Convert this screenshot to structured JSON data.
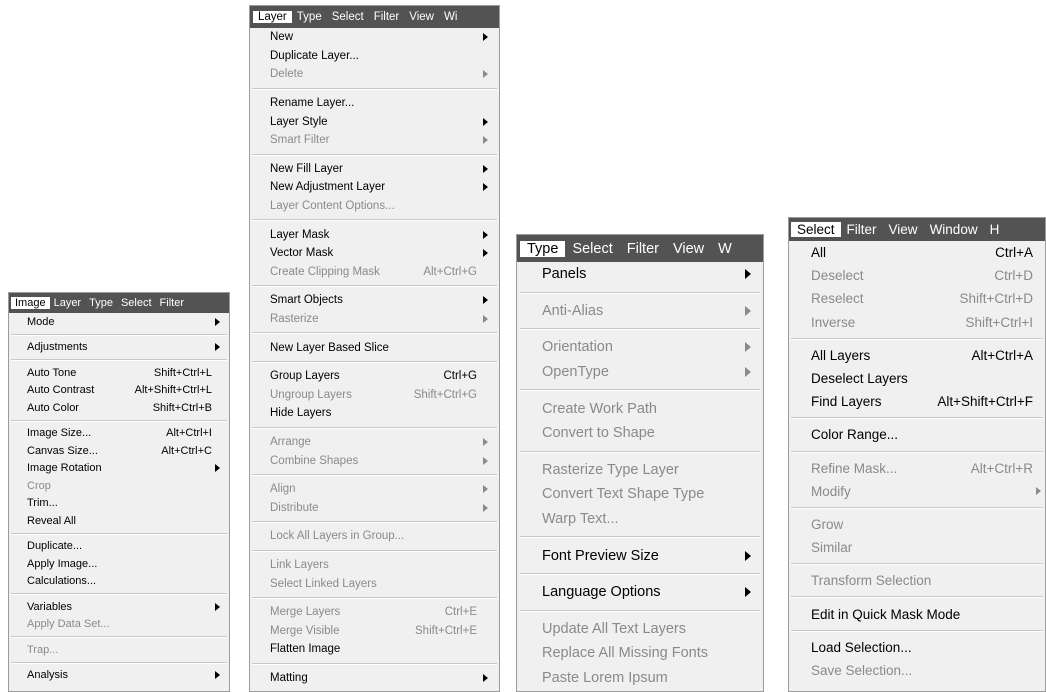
{
  "image_menu": {
    "menubar": [
      "Image",
      "Layer",
      "Type",
      "Select",
      "Filter"
    ],
    "groups": [
      [
        {
          "label": "Mode",
          "submenu": true
        }
      ],
      [
        {
          "label": "Adjustments",
          "submenu": true
        }
      ],
      [
        {
          "label": "Auto Tone",
          "shortcut": "Shift+Ctrl+L"
        },
        {
          "label": "Auto Contrast",
          "shortcut": "Alt+Shift+Ctrl+L"
        },
        {
          "label": "Auto Color",
          "shortcut": "Shift+Ctrl+B"
        }
      ],
      [
        {
          "label": "Image Size...",
          "shortcut": "Alt+Ctrl+I"
        },
        {
          "label": "Canvas Size...",
          "shortcut": "Alt+Ctrl+C"
        },
        {
          "label": "Image Rotation",
          "submenu": true
        },
        {
          "label": "Crop",
          "disabled": true
        },
        {
          "label": "Trim..."
        },
        {
          "label": "Reveal All"
        }
      ],
      [
        {
          "label": "Duplicate..."
        },
        {
          "label": "Apply Image..."
        },
        {
          "label": "Calculations..."
        }
      ],
      [
        {
          "label": "Variables",
          "submenu": true
        },
        {
          "label": "Apply Data Set...",
          "disabled": true
        }
      ],
      [
        {
          "label": "Trap...",
          "disabled": true
        }
      ],
      [
        {
          "label": "Analysis",
          "submenu": true
        }
      ]
    ]
  },
  "layer_menu": {
    "menubar": [
      "Layer",
      "Type",
      "Select",
      "Filter",
      "View",
      "Wi"
    ],
    "groups": [
      [
        {
          "label": "New",
          "submenu": true
        },
        {
          "label": "Duplicate Layer..."
        },
        {
          "label": "Delete",
          "submenu": true,
          "disabled": true
        }
      ],
      [
        {
          "label": "Rename Layer..."
        },
        {
          "label": "Layer Style",
          "submenu": true
        },
        {
          "label": "Smart Filter",
          "submenu": true,
          "disabled": true
        }
      ],
      [
        {
          "label": "New Fill Layer",
          "submenu": true
        },
        {
          "label": "New Adjustment Layer",
          "submenu": true
        },
        {
          "label": "Layer Content Options...",
          "disabled": true
        }
      ],
      [
        {
          "label": "Layer Mask",
          "submenu": true
        },
        {
          "label": "Vector Mask",
          "submenu": true
        },
        {
          "label": "Create Clipping Mask",
          "shortcut": "Alt+Ctrl+G",
          "disabled": true
        }
      ],
      [
        {
          "label": "Smart Objects",
          "submenu": true
        },
        {
          "label": "Rasterize",
          "submenu": true,
          "disabled": true
        }
      ],
      [
        {
          "label": "New Layer Based Slice"
        }
      ],
      [
        {
          "label": "Group Layers",
          "shortcut": "Ctrl+G"
        },
        {
          "label": "Ungroup Layers",
          "shortcut": "Shift+Ctrl+G",
          "disabled": true
        },
        {
          "label": "Hide Layers"
        }
      ],
      [
        {
          "label": "Arrange",
          "submenu": true,
          "disabled": true
        },
        {
          "label": "Combine Shapes",
          "submenu": true,
          "disabled": true
        }
      ],
      [
        {
          "label": "Align",
          "submenu": true,
          "disabled": true
        },
        {
          "label": "Distribute",
          "submenu": true,
          "disabled": true
        }
      ],
      [
        {
          "label": "Lock All Layers in Group...",
          "disabled": true
        }
      ],
      [
        {
          "label": "Link Layers",
          "disabled": true
        },
        {
          "label": "Select Linked Layers",
          "disabled": true
        }
      ],
      [
        {
          "label": "Merge Layers",
          "shortcut": "Ctrl+E",
          "disabled": true
        },
        {
          "label": "Merge Visible",
          "shortcut": "Shift+Ctrl+E",
          "disabled": true
        },
        {
          "label": "Flatten Image"
        }
      ],
      [
        {
          "label": "Matting",
          "submenu": true
        }
      ]
    ]
  },
  "type_menu": {
    "menubar": [
      "Type",
      "Select",
      "Filter",
      "View",
      "W"
    ],
    "groups": [
      [
        {
          "label": "Panels",
          "submenu": true
        }
      ],
      [
        {
          "label": "Anti-Alias",
          "submenu": true,
          "disabled": true
        }
      ],
      [
        {
          "label": "Orientation",
          "submenu": true,
          "disabled": true
        },
        {
          "label": "OpenType",
          "submenu": true,
          "disabled": true
        }
      ],
      [
        {
          "label": "Create Work Path",
          "disabled": true
        },
        {
          "label": "Convert to Shape",
          "disabled": true
        }
      ],
      [
        {
          "label": "Rasterize Type Layer",
          "disabled": true
        },
        {
          "label": "Convert Text Shape Type",
          "disabled": true
        },
        {
          "label": "Warp Text...",
          "disabled": true
        }
      ],
      [
        {
          "label": "Font Preview Size",
          "submenu": true
        }
      ],
      [
        {
          "label": "Language Options",
          "submenu": true
        }
      ],
      [
        {
          "label": "Update All Text Layers",
          "disabled": true
        },
        {
          "label": "Replace All Missing Fonts",
          "disabled": true
        },
        {
          "label": "Paste Lorem Ipsum",
          "disabled": true
        }
      ]
    ]
  },
  "select_menu": {
    "menubar": [
      "Select",
      "Filter",
      "View",
      "Window",
      "H"
    ],
    "groups": [
      [
        {
          "label": "All",
          "shortcut": "Ctrl+A"
        },
        {
          "label": "Deselect",
          "shortcut": "Ctrl+D",
          "disabled": true
        },
        {
          "label": "Reselect",
          "shortcut": "Shift+Ctrl+D",
          "disabled": true
        },
        {
          "label": "Inverse",
          "shortcut": "Shift+Ctrl+I",
          "disabled": true
        }
      ],
      [
        {
          "label": "All Layers",
          "shortcut": "Alt+Ctrl+A"
        },
        {
          "label": "Deselect Layers"
        },
        {
          "label": "Find Layers",
          "shortcut": "Alt+Shift+Ctrl+F"
        }
      ],
      [
        {
          "label": "Color Range..."
        }
      ],
      [
        {
          "label": "Refine Mask...",
          "shortcut": "Alt+Ctrl+R",
          "disabled": true
        },
        {
          "label": "Modify",
          "submenu": true,
          "disabled": true
        }
      ],
      [
        {
          "label": "Grow",
          "disabled": true
        },
        {
          "label": "Similar",
          "disabled": true
        }
      ],
      [
        {
          "label": "Transform Selection",
          "disabled": true
        }
      ],
      [
        {
          "label": "Edit in Quick Mask Mode"
        }
      ],
      [
        {
          "label": "Load Selection..."
        },
        {
          "label": "Save Selection...",
          "disabled": true
        }
      ]
    ]
  }
}
